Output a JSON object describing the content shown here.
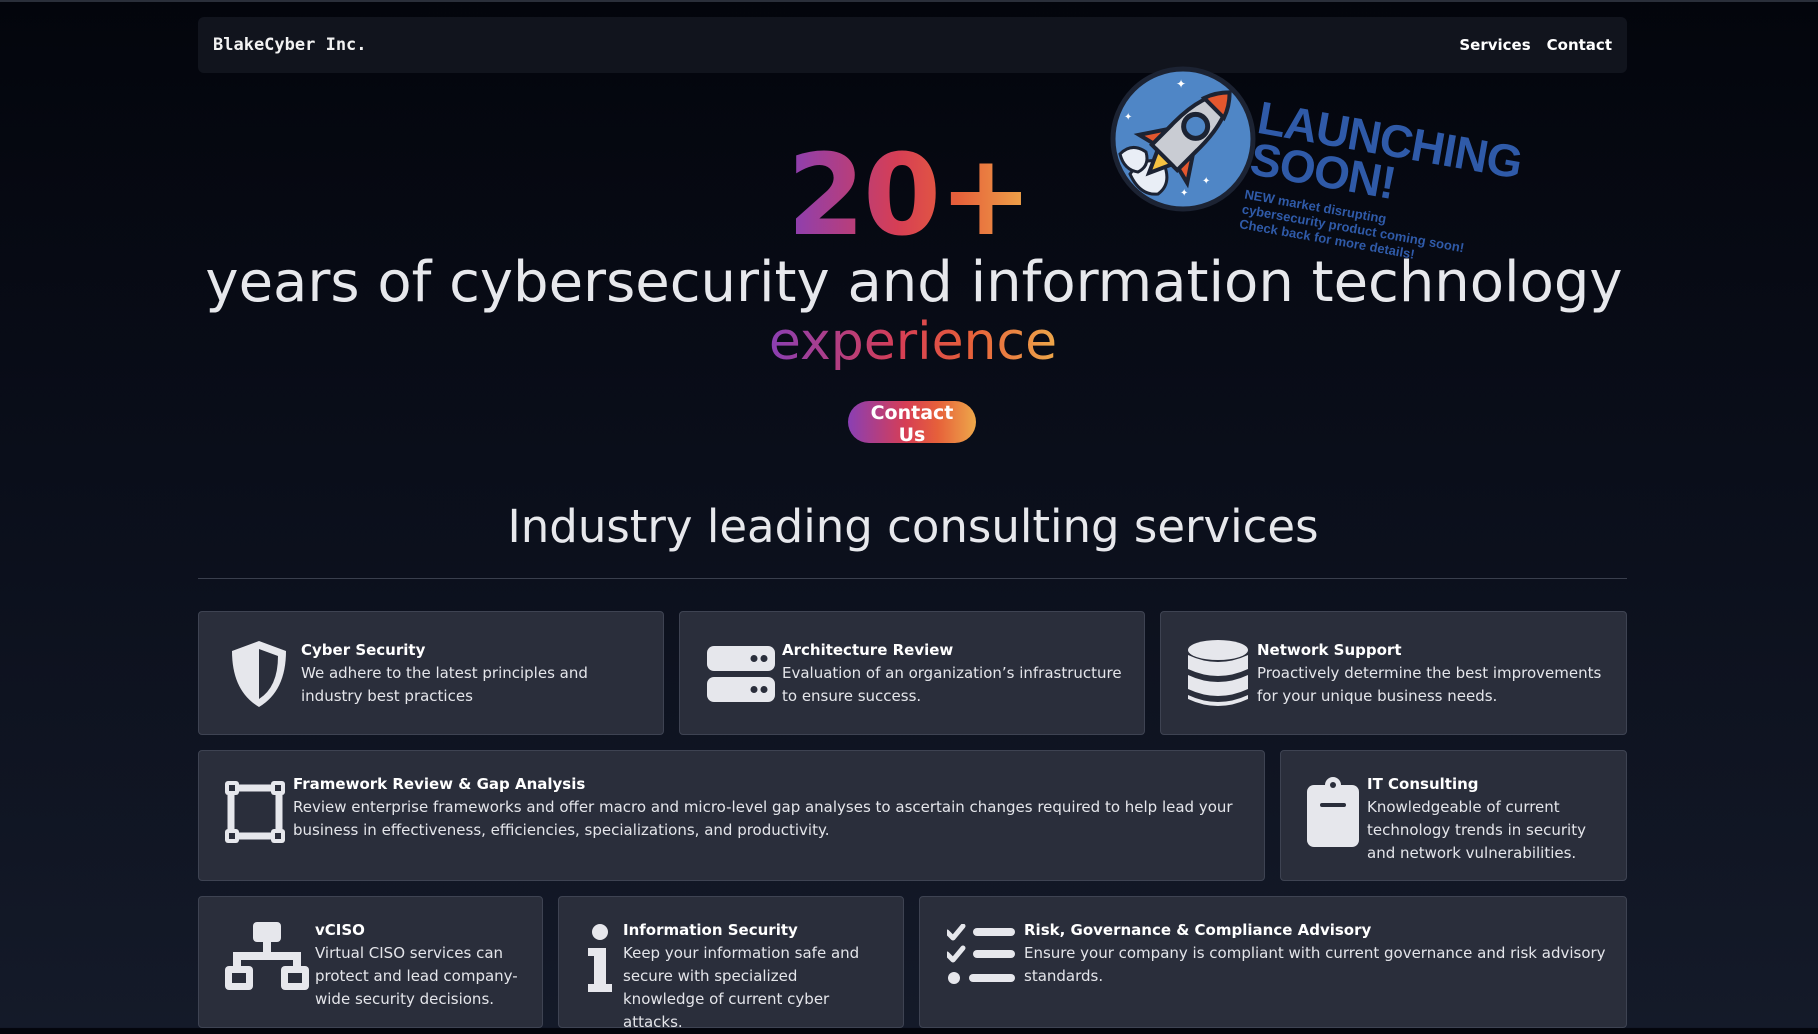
{
  "brand": "BlakeCyber Inc.",
  "nav": {
    "services": "Services",
    "contact": "Contact"
  },
  "hero": {
    "number": "20+",
    "line1": "years of cybersecurity and information technology",
    "line2": "experience",
    "cta": "Contact Us"
  },
  "promo": {
    "headline": "LAUNCHING SOON!",
    "subtext": "NEW market disrupting cybersecurity product coming soon! Check back for more details!"
  },
  "services_title": "Industry leading consulting services",
  "services": [
    {
      "title": "Cyber Security",
      "desc": "We adhere to the latest principles and industry best practices",
      "icon": "shield-icon"
    },
    {
      "title": "Architecture Review",
      "desc": "Evaluation of an organization’s infrastructure to ensure success.",
      "icon": "server-icon"
    },
    {
      "title": "Network Support",
      "desc": "Proactively determine the best improvements for your unique business needs.",
      "icon": "database-icon"
    },
    {
      "title": "Framework Review & Gap Analysis",
      "desc": "Review enterprise frameworks and offer macro and micro-level gap analyses to ascertain changes required to help lead your business in effectiveness, efficiencies, specializations, and productivity.",
      "icon": "vector-square-icon"
    },
    {
      "title": "IT Consulting",
      "desc": "Knowledgeable of current technology trends in security and network vulnerabilities.",
      "icon": "clipboard-icon"
    },
    {
      "title": "vCISO",
      "desc": "Virtual CISO services can protect and lead company-wide security decisions.",
      "icon": "sitemap-icon"
    },
    {
      "title": "Information Security",
      "desc": "Keep your information safe and secure with specialized knowledge of current cyber attacks.",
      "icon": "info-icon"
    },
    {
      "title": "Risk, Governance & Compliance Advisory",
      "desc": "Ensure your company is compliant with current governance and risk advisory standards.",
      "icon": "list-check-icon"
    }
  ],
  "colors": {
    "accent_start": "#8a3fb4",
    "accent_mid": "#d63e55",
    "accent_end": "#eea84a",
    "card_bg": "#2a2e3b",
    "promo_blue": "#2f5aa8"
  }
}
